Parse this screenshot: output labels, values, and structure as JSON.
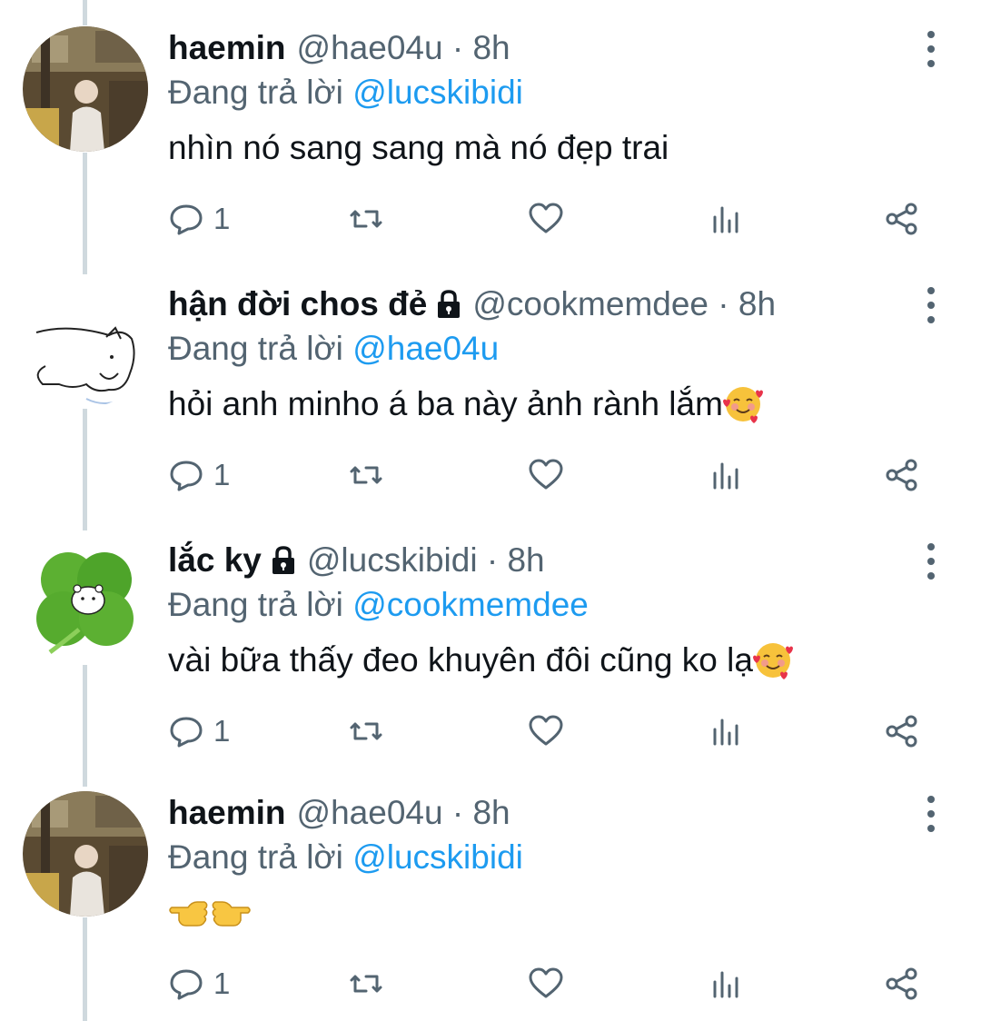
{
  "reply_prefix": "Đang trả lời",
  "tweets": [
    {
      "name": "haemin",
      "handle": "@hae04u",
      "time": "8h",
      "reply_to": "@lucskibidi",
      "text": "nhìn nó sang sang mà nó đẹp trai",
      "locked": false,
      "avatar": "photo-person-icon",
      "emoji": "",
      "reply_count": "1"
    },
    {
      "name": "hận đời chos đẻ",
      "handle": "@cookmemdee",
      "time": "8h",
      "reply_to": "@hae04u",
      "text": "hỏi anh minho á ba này ảnh rành lắm",
      "locked": true,
      "avatar": "cat-sketch-icon",
      "emoji": "smiling-face-with-hearts",
      "reply_count": "1"
    },
    {
      "name": "lắc ky",
      "handle": "@lucskibidi",
      "time": "8h",
      "reply_to": "@cookmemdee",
      "text": "vài bữa thấy đeo khuyên đôi cũng ko lạ",
      "locked": true,
      "avatar": "four-leaf-clover-icon",
      "emoji": "smiling-face-with-hearts",
      "reply_count": "1"
    },
    {
      "name": "haemin",
      "handle": "@hae04u",
      "time": "8h",
      "reply_to": "@lucskibidi",
      "text": "",
      "locked": false,
      "avatar": "photo-person-icon",
      "emoji": "pointing-hands",
      "reply_count": "1"
    }
  ],
  "colors": {
    "accent": "#1d9bf0",
    "secondary_text": "#536471",
    "thread_line": "#cfd9de"
  }
}
